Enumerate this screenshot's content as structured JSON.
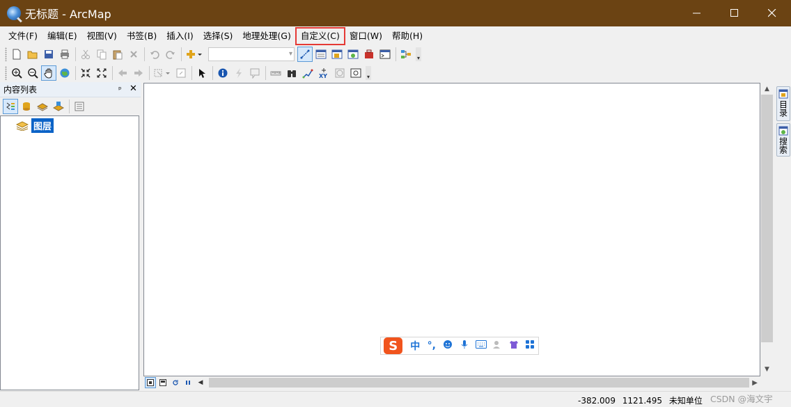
{
  "window": {
    "title": "无标题 - ArcMap",
    "minimize": "—",
    "maximize": "☐",
    "close": "✕"
  },
  "menu": [
    {
      "label": "文件(F)"
    },
    {
      "label": "编辑(E)"
    },
    {
      "label": "视图(V)"
    },
    {
      "label": "书签(B)"
    },
    {
      "label": "插入(I)"
    },
    {
      "label": "选择(S)"
    },
    {
      "label": "地理处理(G)"
    },
    {
      "label": "自定义(C)",
      "highlighted": true
    },
    {
      "label": "窗口(W)"
    },
    {
      "label": "帮助(H)"
    }
  ],
  "toolbar1": {
    "scale_value": "",
    "icons": [
      "new-document-icon",
      "open-folder-icon",
      "save-icon",
      "print-icon",
      "cut-icon",
      "copy-icon",
      "paste-icon",
      "delete-icon",
      "undo-icon",
      "redo-icon",
      "add-data-icon",
      "editor-toolbar-icon",
      "table-window-icon",
      "catalog-icon",
      "search-window-icon",
      "arctoolbox-icon",
      "python-icon",
      "modelbuilder-icon"
    ]
  },
  "toolbar2": {
    "icons": [
      "zoom-in-icon",
      "zoom-out-icon",
      "pan-icon",
      "full-extent-icon",
      "fixed-zoom-in-icon",
      "fixed-zoom-out-icon",
      "back-extent-icon",
      "forward-extent-icon",
      "select-features-icon",
      "clear-selection-icon",
      "select-elements-icon",
      "identify-icon",
      "hyperlink-icon",
      "html-popup-icon",
      "measure-icon",
      "find-icon",
      "find-route-icon",
      "go-to-xy-icon",
      "time-slider-icon",
      "magnifier-icon"
    ]
  },
  "toc": {
    "title": "内容列表",
    "pin": "ᵖ",
    "close": "✕",
    "layer_label": "图层"
  },
  "dock": {
    "catalog_label": "目录",
    "search_label": "搜索"
  },
  "ime": {
    "logo": "S",
    "items": [
      "中",
      "°,",
      "☺",
      "🎤",
      "⌨",
      "👤",
      "👕",
      "▦"
    ]
  },
  "status": {
    "x": "-382.009",
    "y": "1121.495",
    "units": "未知单位",
    "watermark": "CSDN @海文宇"
  },
  "colors": {
    "titlebar": "#6b4313",
    "selection": "#0b63c7",
    "highlight_box": "#e53935"
  }
}
